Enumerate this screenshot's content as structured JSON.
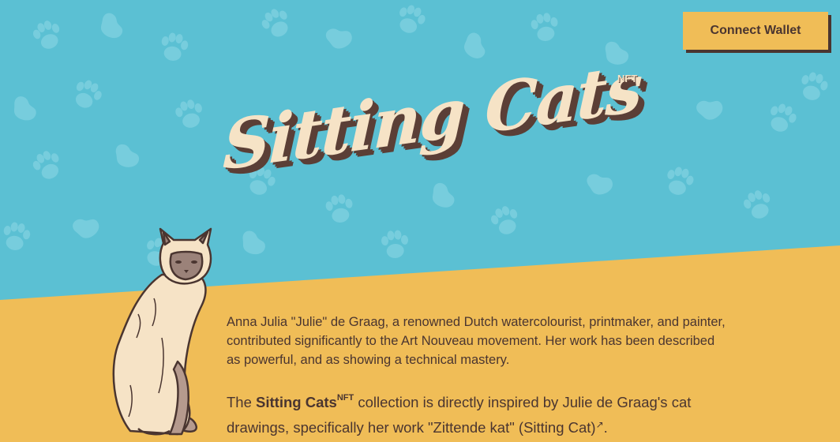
{
  "header": {
    "connect_button_label": "Connect Wallet"
  },
  "logo": {
    "title": "Sitting Cats",
    "badge": "NFT"
  },
  "intro": {
    "paragraph1": "Anna Julia \"Julie\" de Graag, a renowned Dutch watercolourist, printmaker, and painter, contributed significantly to the Art Nouveau movement. Her work has been described as powerful, and as showing a technical mastery.",
    "p2_prefix": "The ",
    "p2_brand": "Sitting Cats",
    "p2_brand_sup": "NFT",
    "p2_middle": " collection is directly inspired by Julie de Graag's cat drawings, specifically her work \"Zittende kat\" (Sitting Cat)",
    "p2_suffix": "."
  },
  "colors": {
    "sky": "#5bc0d3",
    "paw": "#7ccfdf",
    "yellow": "#f0bd57",
    "brown": "#4a3530",
    "cream": "#f6e3c6"
  },
  "icons": {
    "external_link": "external-link-icon",
    "paw_print": "paw-print-icon"
  }
}
